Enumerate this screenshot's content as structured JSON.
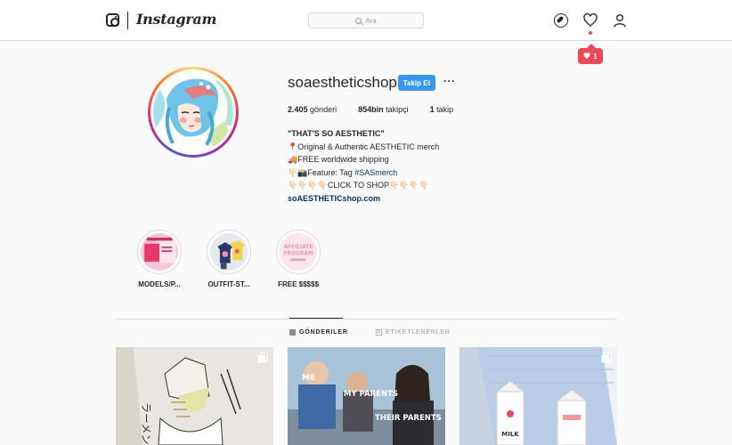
{
  "nav": {
    "brand": "Instagram",
    "search_placeholder": "Ara",
    "notification_count": "1",
    "icons": [
      "instagram-glyph-icon",
      "search-icon",
      "compass-icon",
      "heart-icon",
      "profile-icon"
    ],
    "notification_color": "#ed4956"
  },
  "profile": {
    "username": "soaestheticshop",
    "follow_label": "Takip Et",
    "more_label": "···",
    "stats": [
      {
        "value": "2.405",
        "label": "gönderi"
      },
      {
        "value": "854bin",
        "label": "takipçi"
      },
      {
        "value": "1",
        "label": "takip"
      }
    ],
    "bio_title": "\"THAT'S SO AESTHETIC\"",
    "bio_lines": [
      "📍Original & Authentic AESTHETIC merch",
      "🚚FREE worldwide shipping",
      "👇🏻📸Feature: Tag",
      "👇🏻👇🏻👇🏻👇🏻CLICK TO SHOP👇🏻👇🏻👇🏻👇🏻"
    ],
    "bio_hashtag": "#SASmerch",
    "website": "soAESTHETICshop.com",
    "accent_color": "#3897f0"
  },
  "highlights": [
    {
      "label": "MODELS/P..."
    },
    {
      "label": "OUTFIT-ST..."
    },
    {
      "label": "FREE $$$$$"
    }
  ],
  "tabs": [
    {
      "label": "GÖNDERILER",
      "active": true,
      "icon": "grid-icon"
    },
    {
      "label": "ETİKETLENENLER",
      "active": false,
      "icon": "tagged-icon"
    }
  ],
  "posts": [
    {
      "caption_lines": [
        "ラーメン"
      ],
      "icon": "multi-post-icon"
    },
    {
      "labels": [
        "ME",
        "MY PARENTS",
        "THEIR PARENTS"
      ],
      "icon": "multi-post-icon"
    },
    {
      "labels": [
        "MILK"
      ],
      "icon": "multi-post-icon"
    }
  ]
}
